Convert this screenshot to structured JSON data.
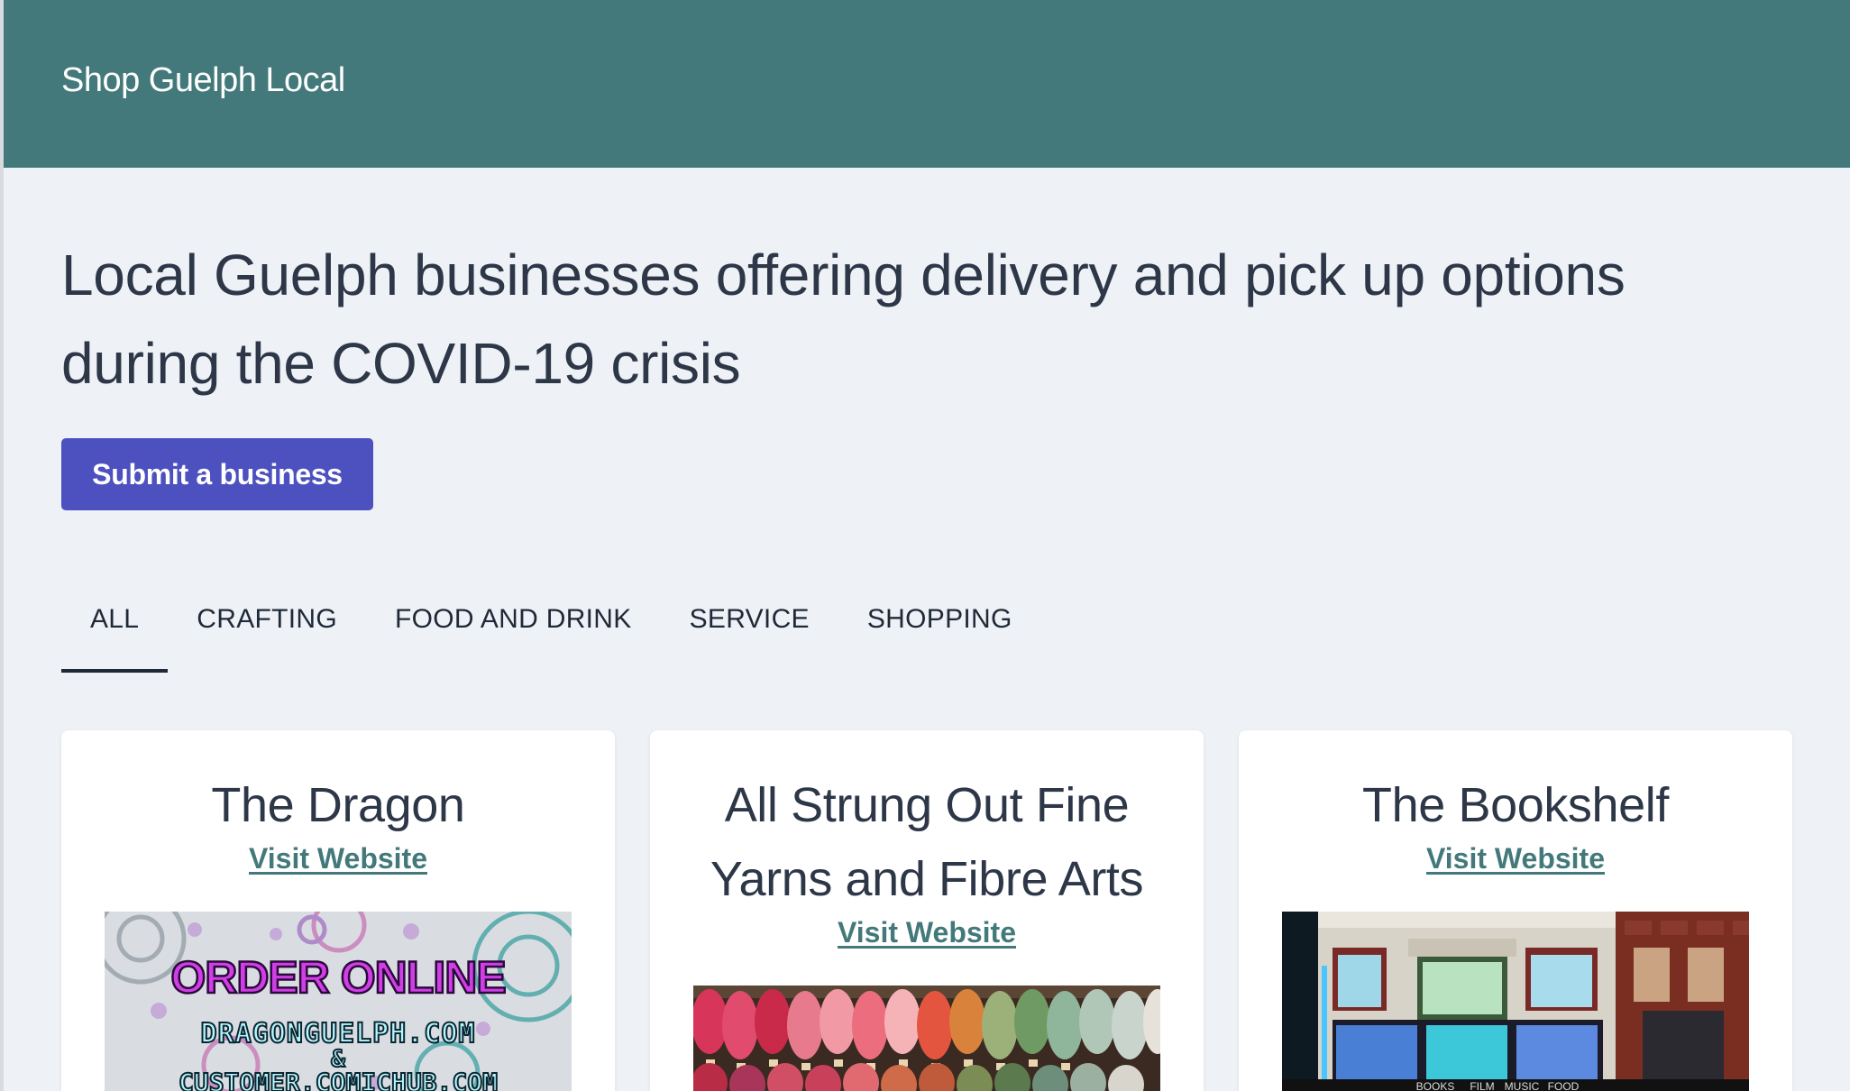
{
  "header": {
    "brand": "Shop Guelph Local"
  },
  "hero": {
    "title": "Local Guelph businesses offering delivery and pick up options during the COVID-19 crisis",
    "submit_label": "Submit a business"
  },
  "tabs": [
    {
      "label": "ALL",
      "active": true
    },
    {
      "label": "CRAFTING",
      "active": false
    },
    {
      "label": "FOOD AND DRINK",
      "active": false
    },
    {
      "label": "SERVICE",
      "active": false
    },
    {
      "label": "SHOPPING",
      "active": false
    }
  ],
  "cards": [
    {
      "name": "The Dragon",
      "link_label": "Visit Website",
      "image_text": [
        "ORDER ONLINE",
        "DRAGONGUELPH.COM",
        "&",
        "CUSTOMER.COMICHUB.COM"
      ]
    },
    {
      "name": "All Strung Out Fine Yarns and Fibre Arts",
      "link_label": "Visit Website"
    },
    {
      "name": "The Bookshelf",
      "link_label": "Visit Website",
      "image_text": [
        "BOOKS",
        "FILM",
        "MUSIC",
        "FOOD"
      ]
    }
  ],
  "colors": {
    "header_bg": "#43797a",
    "page_bg": "#eef1f6",
    "button_bg": "#4c51bf",
    "link": "#43797a",
    "text": "#2d3748"
  }
}
